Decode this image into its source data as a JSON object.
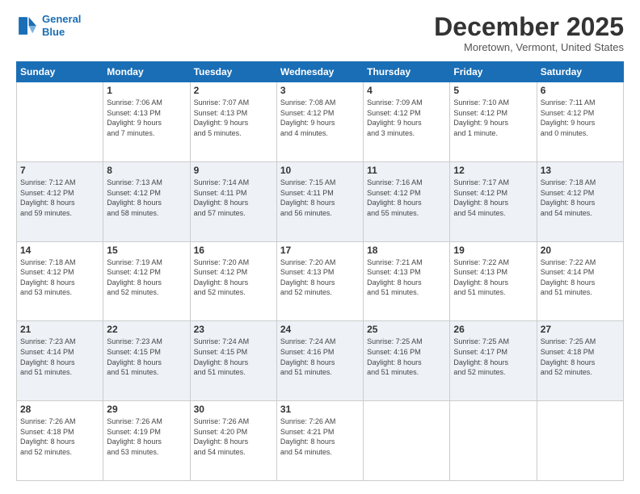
{
  "header": {
    "logo_line1": "General",
    "logo_line2": "Blue",
    "month": "December 2025",
    "location": "Moretown, Vermont, United States"
  },
  "weekdays": [
    "Sunday",
    "Monday",
    "Tuesday",
    "Wednesday",
    "Thursday",
    "Friday",
    "Saturday"
  ],
  "weeks": [
    [
      {
        "day": "",
        "info": ""
      },
      {
        "day": "1",
        "info": "Sunrise: 7:06 AM\nSunset: 4:13 PM\nDaylight: 9 hours\nand 7 minutes."
      },
      {
        "day": "2",
        "info": "Sunrise: 7:07 AM\nSunset: 4:13 PM\nDaylight: 9 hours\nand 5 minutes."
      },
      {
        "day": "3",
        "info": "Sunrise: 7:08 AM\nSunset: 4:12 PM\nDaylight: 9 hours\nand 4 minutes."
      },
      {
        "day": "4",
        "info": "Sunrise: 7:09 AM\nSunset: 4:12 PM\nDaylight: 9 hours\nand 3 minutes."
      },
      {
        "day": "5",
        "info": "Sunrise: 7:10 AM\nSunset: 4:12 PM\nDaylight: 9 hours\nand 1 minute."
      },
      {
        "day": "6",
        "info": "Sunrise: 7:11 AM\nSunset: 4:12 PM\nDaylight: 9 hours\nand 0 minutes."
      }
    ],
    [
      {
        "day": "7",
        "info": "Sunrise: 7:12 AM\nSunset: 4:12 PM\nDaylight: 8 hours\nand 59 minutes."
      },
      {
        "day": "8",
        "info": "Sunrise: 7:13 AM\nSunset: 4:12 PM\nDaylight: 8 hours\nand 58 minutes."
      },
      {
        "day": "9",
        "info": "Sunrise: 7:14 AM\nSunset: 4:11 PM\nDaylight: 8 hours\nand 57 minutes."
      },
      {
        "day": "10",
        "info": "Sunrise: 7:15 AM\nSunset: 4:11 PM\nDaylight: 8 hours\nand 56 minutes."
      },
      {
        "day": "11",
        "info": "Sunrise: 7:16 AM\nSunset: 4:12 PM\nDaylight: 8 hours\nand 55 minutes."
      },
      {
        "day": "12",
        "info": "Sunrise: 7:17 AM\nSunset: 4:12 PM\nDaylight: 8 hours\nand 54 minutes."
      },
      {
        "day": "13",
        "info": "Sunrise: 7:18 AM\nSunset: 4:12 PM\nDaylight: 8 hours\nand 54 minutes."
      }
    ],
    [
      {
        "day": "14",
        "info": "Sunrise: 7:18 AM\nSunset: 4:12 PM\nDaylight: 8 hours\nand 53 minutes."
      },
      {
        "day": "15",
        "info": "Sunrise: 7:19 AM\nSunset: 4:12 PM\nDaylight: 8 hours\nand 52 minutes."
      },
      {
        "day": "16",
        "info": "Sunrise: 7:20 AM\nSunset: 4:12 PM\nDaylight: 8 hours\nand 52 minutes."
      },
      {
        "day": "17",
        "info": "Sunrise: 7:20 AM\nSunset: 4:13 PM\nDaylight: 8 hours\nand 52 minutes."
      },
      {
        "day": "18",
        "info": "Sunrise: 7:21 AM\nSunset: 4:13 PM\nDaylight: 8 hours\nand 51 minutes."
      },
      {
        "day": "19",
        "info": "Sunrise: 7:22 AM\nSunset: 4:13 PM\nDaylight: 8 hours\nand 51 minutes."
      },
      {
        "day": "20",
        "info": "Sunrise: 7:22 AM\nSunset: 4:14 PM\nDaylight: 8 hours\nand 51 minutes."
      }
    ],
    [
      {
        "day": "21",
        "info": "Sunrise: 7:23 AM\nSunset: 4:14 PM\nDaylight: 8 hours\nand 51 minutes."
      },
      {
        "day": "22",
        "info": "Sunrise: 7:23 AM\nSunset: 4:15 PM\nDaylight: 8 hours\nand 51 minutes."
      },
      {
        "day": "23",
        "info": "Sunrise: 7:24 AM\nSunset: 4:15 PM\nDaylight: 8 hours\nand 51 minutes."
      },
      {
        "day": "24",
        "info": "Sunrise: 7:24 AM\nSunset: 4:16 PM\nDaylight: 8 hours\nand 51 minutes."
      },
      {
        "day": "25",
        "info": "Sunrise: 7:25 AM\nSunset: 4:16 PM\nDaylight: 8 hours\nand 51 minutes."
      },
      {
        "day": "26",
        "info": "Sunrise: 7:25 AM\nSunset: 4:17 PM\nDaylight: 8 hours\nand 52 minutes."
      },
      {
        "day": "27",
        "info": "Sunrise: 7:25 AM\nSunset: 4:18 PM\nDaylight: 8 hours\nand 52 minutes."
      }
    ],
    [
      {
        "day": "28",
        "info": "Sunrise: 7:26 AM\nSunset: 4:18 PM\nDaylight: 8 hours\nand 52 minutes."
      },
      {
        "day": "29",
        "info": "Sunrise: 7:26 AM\nSunset: 4:19 PM\nDaylight: 8 hours\nand 53 minutes."
      },
      {
        "day": "30",
        "info": "Sunrise: 7:26 AM\nSunset: 4:20 PM\nDaylight: 8 hours\nand 54 minutes."
      },
      {
        "day": "31",
        "info": "Sunrise: 7:26 AM\nSunset: 4:21 PM\nDaylight: 8 hours\nand 54 minutes."
      },
      {
        "day": "",
        "info": ""
      },
      {
        "day": "",
        "info": ""
      },
      {
        "day": "",
        "info": ""
      }
    ]
  ]
}
